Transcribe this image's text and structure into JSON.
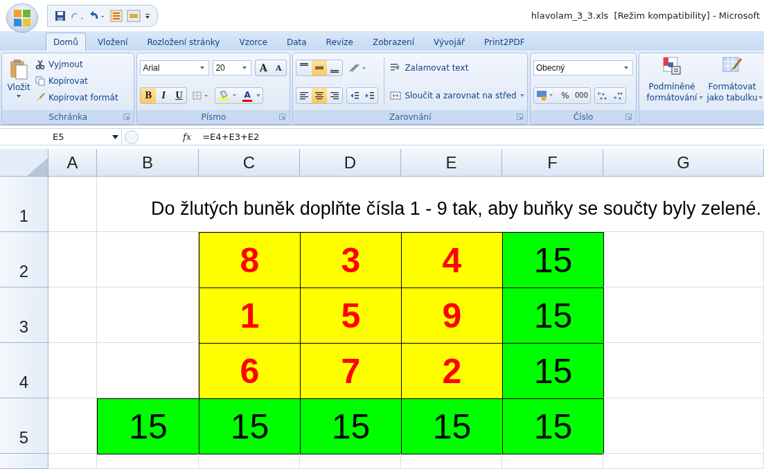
{
  "window": {
    "title": "hlavolam_3_3.xls  [Režim kompatibility] - Microsoft"
  },
  "tabs": [
    {
      "label": "Domů",
      "selected": true
    },
    {
      "label": "Vložení",
      "selected": false
    },
    {
      "label": "Rozložení stránky",
      "selected": false
    },
    {
      "label": "Vzorce",
      "selected": false
    },
    {
      "label": "Data",
      "selected": false
    },
    {
      "label": "Revize",
      "selected": false
    },
    {
      "label": "Zobrazení",
      "selected": false
    },
    {
      "label": "Vývojář",
      "selected": false
    },
    {
      "label": "Print2PDF",
      "selected": false
    }
  ],
  "clipboard": {
    "group": "Schránka",
    "paste": "Vložit",
    "items": [
      "Vyjmout",
      "Kopírovat",
      "Kopírovat formát"
    ]
  },
  "font": {
    "group": "Písmo",
    "name": "Arial",
    "size": "20",
    "grow": "A",
    "shrink": "A",
    "font_color_label": "A",
    "style_buttons": [
      {
        "label": "B",
        "selected": true
      },
      {
        "label": "I",
        "selected": false
      },
      {
        "label": "U",
        "selected": false
      }
    ]
  },
  "alignment": {
    "group": "Zarovnání",
    "wrap": "Zalamovat text",
    "merge": "Sloučit a zarovnat na střed",
    "vertical": [
      {
        "selected": false
      },
      {
        "selected": true
      },
      {
        "selected": false
      }
    ],
    "horizontal": [
      {
        "selected": false
      },
      {
        "selected": true
      },
      {
        "selected": false
      }
    ]
  },
  "number": {
    "group": "Číslo",
    "format": "Obecný",
    "percent": "%",
    "thousands": "000"
  },
  "styles": {
    "conditional": "Podmíněné formátování",
    "table": "Formátovat jako tabulku"
  },
  "formula_bar": {
    "name_box": "E5",
    "fx": "fx",
    "formula": "=E4+E3+E2"
  },
  "sheet": {
    "columns": [
      "A",
      "B",
      "C",
      "D",
      "E",
      "F",
      "G"
    ],
    "rows": [
      {
        "number": "1",
        "note": "Do žlutých buněk doplňte čísla 1 - 9 tak, aby buňky se součty byly zelené."
      },
      {
        "number": "2",
        "cells": [
          {
            "kind": "empty"
          },
          {
            "kind": "empty"
          },
          {
            "kind": "input",
            "value": "8"
          },
          {
            "kind": "input",
            "value": "3"
          },
          {
            "kind": "input",
            "value": "4"
          },
          {
            "kind": "sum",
            "value": "15"
          },
          {
            "kind": "empty"
          }
        ]
      },
      {
        "number": "3",
        "cells": [
          {
            "kind": "empty"
          },
          {
            "kind": "empty"
          },
          {
            "kind": "input",
            "value": "1"
          },
          {
            "kind": "input",
            "value": "5"
          },
          {
            "kind": "input",
            "value": "9"
          },
          {
            "kind": "sum",
            "value": "15"
          },
          {
            "kind": "empty"
          }
        ]
      },
      {
        "number": "4",
        "cells": [
          {
            "kind": "empty"
          },
          {
            "kind": "empty"
          },
          {
            "kind": "input",
            "value": "6"
          },
          {
            "kind": "input",
            "value": "7"
          },
          {
            "kind": "input",
            "value": "2"
          },
          {
            "kind": "sum",
            "value": "15"
          },
          {
            "kind": "empty"
          }
        ]
      },
      {
        "number": "5",
        "cells": [
          {
            "kind": "empty"
          },
          {
            "kind": "sum",
            "value": "15"
          },
          {
            "kind": "sum",
            "value": "15"
          },
          {
            "kind": "sum",
            "value": "15"
          },
          {
            "kind": "sum",
            "value": "15"
          },
          {
            "kind": "sum",
            "value": "15"
          },
          {
            "kind": "empty"
          }
        ]
      }
    ]
  }
}
